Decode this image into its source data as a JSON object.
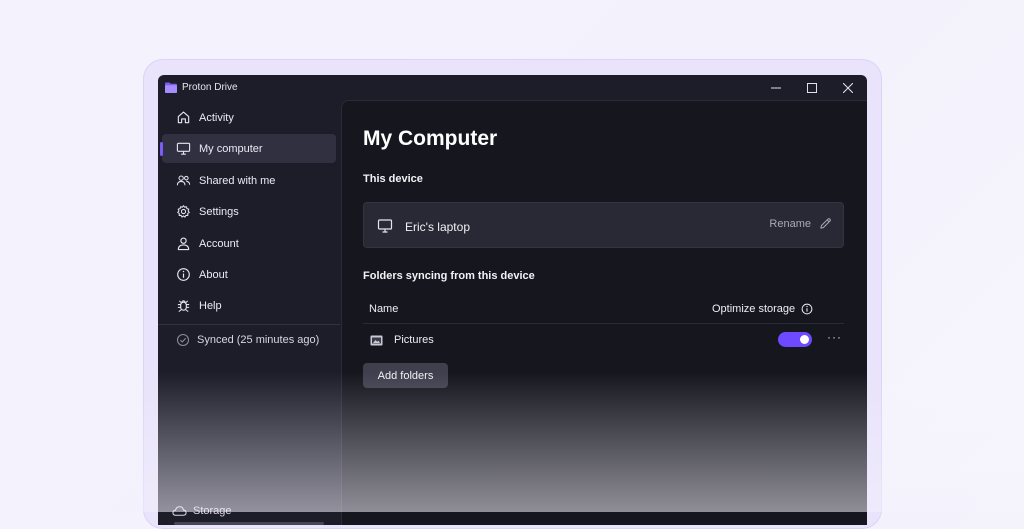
{
  "window": {
    "title": "Proton Drive",
    "accent_color": "#6d4aff"
  },
  "sidebar": {
    "items": [
      {
        "label": "Activity",
        "icon": "home-icon"
      },
      {
        "label": "My computer",
        "icon": "monitor-icon",
        "active": true
      },
      {
        "label": "Shared with me",
        "icon": "users-icon"
      },
      {
        "label": "Settings",
        "icon": "gear-icon"
      },
      {
        "label": "Account",
        "icon": "user-icon"
      },
      {
        "label": "About",
        "icon": "info-icon"
      },
      {
        "label": "Help",
        "icon": "bug-icon"
      }
    ],
    "sync_status": "Synced (25 minutes ago)",
    "storage_label": "Storage"
  },
  "main": {
    "title": "My Computer",
    "this_device_label": "This device",
    "device": {
      "name": "Eric's laptop",
      "rename_label": "Rename"
    },
    "folders_section_label": "Folders syncing from this device",
    "table": {
      "col_name": "Name",
      "col_optimize": "Optimize storage",
      "rows": [
        {
          "name": "Pictures",
          "optimize_storage": true,
          "more": "···"
        }
      ]
    },
    "add_folders_label": "Add folders"
  }
}
